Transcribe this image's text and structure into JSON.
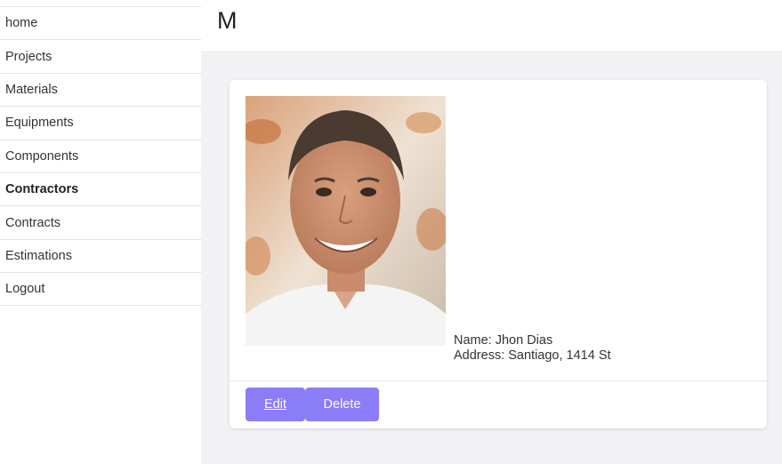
{
  "header": {
    "title": "M"
  },
  "sidebar": {
    "items": [
      {
        "label": "home"
      },
      {
        "label": "Projects"
      },
      {
        "label": "Materials"
      },
      {
        "label": "Equipments"
      },
      {
        "label": "Components"
      },
      {
        "label": "Contractors",
        "active": true
      },
      {
        "label": "Contracts"
      },
      {
        "label": "Estimations"
      },
      {
        "label": "Logout"
      }
    ]
  },
  "contractor": {
    "name_line": "Name: Jhon Dias",
    "address_line": "Address: Santiago, 1414 St"
  },
  "actions": {
    "edit_label": "Edit",
    "delete_label": "Delete"
  },
  "colors": {
    "button": "#8b7cf8",
    "main_background": "#f2f2f4",
    "divider": "#e3e3e3"
  }
}
